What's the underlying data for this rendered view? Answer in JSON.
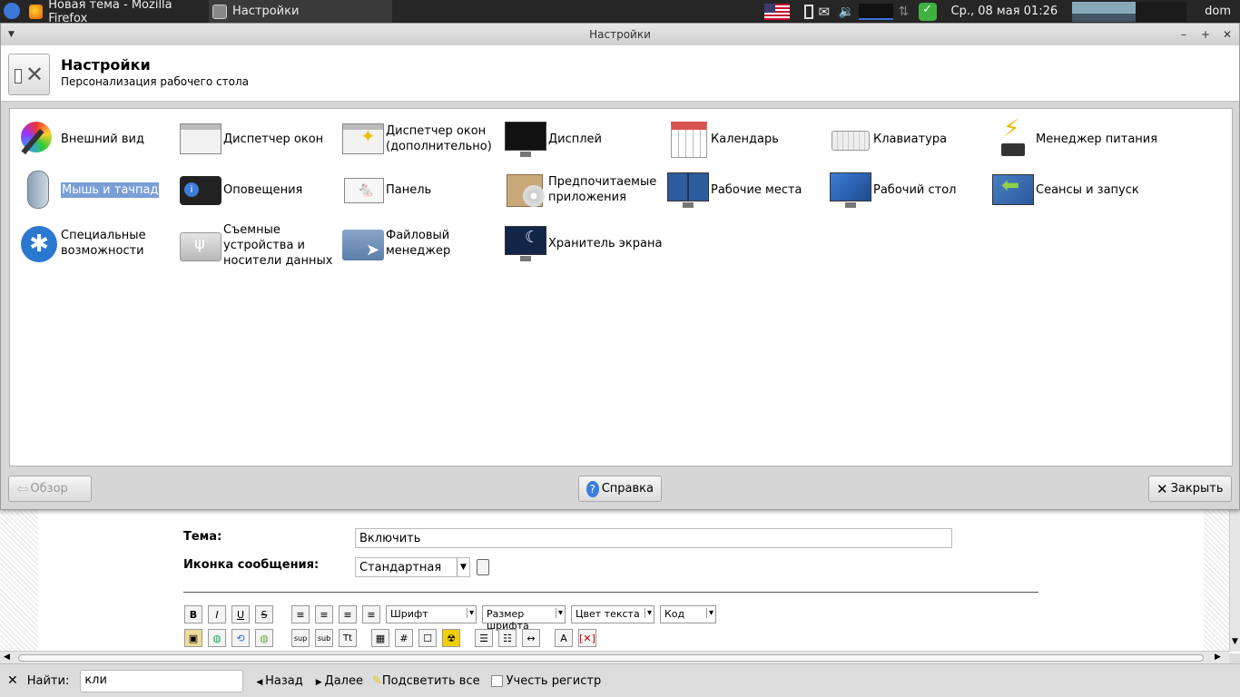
{
  "panel": {
    "tasks": [
      {
        "label": "Новая тема - Mozilla Firefox",
        "icon": "firefox-icon"
      },
      {
        "label": "Настройки",
        "icon": "settings-icon"
      }
    ],
    "clock": "Ср., 08 мая  01:26",
    "user": "dom"
  },
  "window": {
    "title": "Настройки",
    "header_title": "Настройки",
    "header_subtitle": "Персонализация рабочего стола",
    "items": [
      {
        "label": "Внешний вид",
        "icon": "appearance-icon"
      },
      {
        "label": "Диспетчер окон",
        "icon": "window-manager-icon"
      },
      {
        "label": "Диспетчер окон (дополнительно)",
        "icon": "window-manager-tweaks-icon"
      },
      {
        "label": "Дисплей",
        "icon": "display-icon"
      },
      {
        "label": "Календарь",
        "icon": "calendar-icon"
      },
      {
        "label": "Клавиатура",
        "icon": "keyboard-icon"
      },
      {
        "label": "Менеджер питания",
        "icon": "power-manager-icon"
      },
      {
        "label": "Мышь и тачпад",
        "icon": "mouse-icon"
      },
      {
        "label": "Оповещения",
        "icon": "notifications-icon"
      },
      {
        "label": "Панель",
        "icon": "panel-icon"
      },
      {
        "label": "Предпочитаемые приложения",
        "icon": "preferred-apps-icon"
      },
      {
        "label": "Рабочие места",
        "icon": "workspaces-icon"
      },
      {
        "label": "Рабочий стол",
        "icon": "desktop-icon"
      },
      {
        "label": "Сеансы и запуск",
        "icon": "session-icon"
      },
      {
        "label": "Специальные возможности",
        "icon": "accessibility-icon"
      },
      {
        "label": "Съемные устройства и носители данных",
        "icon": "removable-drives-icon"
      },
      {
        "label": "Файловый менеджер",
        "icon": "file-manager-icon"
      },
      {
        "label": "Хранитель экрана",
        "icon": "screensaver-icon"
      }
    ],
    "buttons": {
      "back": "Обзор",
      "help": "Справка",
      "close": "Закрыть"
    }
  },
  "form": {
    "subject_label": "Тема:",
    "subject_value": "Включить",
    "icon_label": "Иконка сообщения:",
    "icon_value": "Стандартная",
    "font_select": "Шрифт",
    "size_select": "Размер шрифта",
    "color_select": "Цвет текста",
    "code_select": "Код"
  },
  "findbar": {
    "label": "Найти:",
    "value": "кли",
    "prev": "Назад",
    "next": "Далее",
    "highlight": "Подсветить все",
    "match_case": "Учесть регистр"
  }
}
